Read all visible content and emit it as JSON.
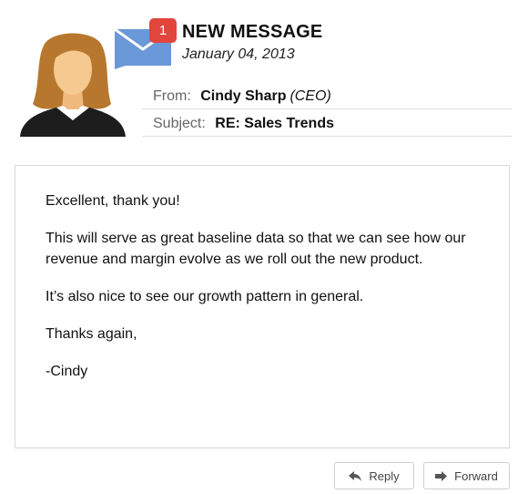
{
  "header": {
    "badge_count": "1",
    "title": "NEW MESSAGE",
    "date": "January 04, 2013"
  },
  "meta": {
    "from_label": "From:",
    "from_name": "Cindy Sharp",
    "from_role": "(CEO)",
    "subject_label": "Subject:",
    "subject_value": "RE: Sales Trends"
  },
  "body": {
    "paragraphs": [
      "Excellent, thank you!",
      "This will serve as great baseline data so that we can see how our revenue and margin evolve as we roll out the new product.",
      "It’s also nice to see our growth pattern in general.",
      "Thanks again,",
      "-Cindy"
    ]
  },
  "actions": {
    "reply_label": "Reply",
    "forward_label": "Forward"
  },
  "icons": {
    "avatar": "avatar-woman",
    "mail": "envelope-icon",
    "reply": "reply-arrow-icon",
    "forward": "forward-arrow-icon"
  },
  "colors": {
    "badge": "#e2453c",
    "envelope": "#6a98d8",
    "hair": "#b8772e",
    "skin": "#f5c98f",
    "suit": "#1d1d1d"
  }
}
